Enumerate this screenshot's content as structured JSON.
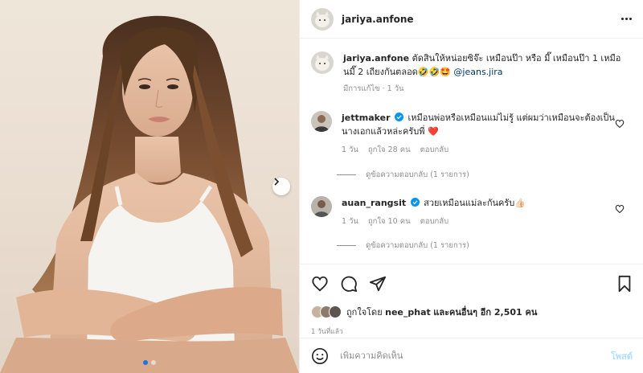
{
  "post": {
    "username": "jariya.anfone",
    "more_icon": "more-horizontal-icon",
    "photo": {
      "carousel_total": 2,
      "carousel_active": 1
    }
  },
  "caption": {
    "username": "jariya.anfone",
    "text": "ตัดสินให้หน่อยซิจ๊ะ เหมือนป๊า หรือ มี๊ เหมือนป๊า 1 เหมือนมี๊ 2 เถียงกันตลอด🤣🤣🤩",
    "mention": "@jeans.jira",
    "meta": "มีการแก้ไข · 1 วัน"
  },
  "comments": [
    {
      "username": "jettmaker",
      "verified": true,
      "text": "เหมือนพ่อหรือเหมือนแม่ไม่รู้ แต่ผมว่าเหมือนจะต้องเป็นนางเอกแล้วหล่ะครับพี่ ❤️",
      "time": "1 วัน",
      "likes": "ถูกใจ 28 คน",
      "reply": "ตอบกลับ",
      "view_replies": "ดูข้อความตอบกลับ (1 รายการ)"
    },
    {
      "username": "auan_rangsit",
      "verified": true,
      "text": "สวยเหมือนแม่ละกันครับ👍🏻",
      "time": "1 วัน",
      "likes": "ถูกใจ 10 คน",
      "reply": "ตอบกลับ",
      "view_replies": "ดูข้อความตอบกลับ (1 รายการ)"
    }
  ],
  "actions": {
    "liked_by_prefix": "ถูกใจโดย",
    "liked_by_user": "nee_phat",
    "liked_by_suffix": "และคนอื่นๆ อีก 2,501 คน",
    "posted_time": "1 วันที่แล้ว"
  },
  "add_comment": {
    "placeholder": "เพิ่มความคิดเห็น",
    "post_label": "โพสต์"
  },
  "colors": {
    "accent": "#0095f6",
    "link": "#00376b",
    "muted": "#8e8e8e",
    "heart_red": "#ed4956"
  }
}
